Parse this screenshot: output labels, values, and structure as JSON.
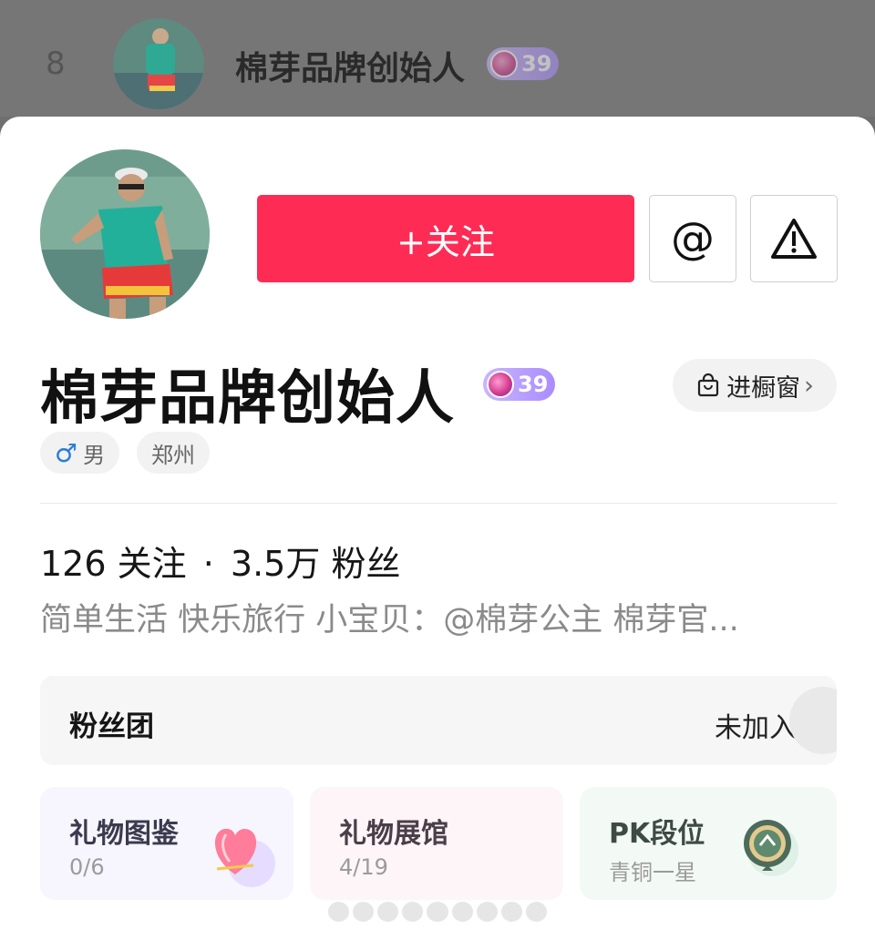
{
  "background_row": {
    "rank": "8",
    "name": "棉芽品牌创始人",
    "level": "39"
  },
  "profile": {
    "name": "棉芽品牌创始人",
    "level": "39",
    "follow_label": "+关注",
    "at_icon": "@",
    "shop_label": "进橱窗",
    "gender_symbol": "♂",
    "gender": "男",
    "location": "郑州",
    "following_count": "126",
    "following_label": "关注",
    "separator": "·",
    "fans_count": "3.5万",
    "fans_label": "粉丝",
    "bio": "简单生活 快乐旅行 小宝贝：@棉芽公主 棉芽官..."
  },
  "fan_club": {
    "title": "粉丝团",
    "status": "未加入"
  },
  "cards": [
    {
      "title": "礼物图鉴",
      "sub": "0/6",
      "icon": "heart-balloon-icon",
      "color": "#3b3b4f"
    },
    {
      "title": "礼物展馆",
      "sub": "4/19",
      "icon": "none",
      "color": "#4a3f48"
    },
    {
      "title": "PK段位",
      "sub": "青铜一星",
      "icon": "bronze-medal-icon",
      "color": "#3e4a44"
    }
  ],
  "colors": {
    "accent": "#fe2c55",
    "badge": "#a98cff"
  }
}
